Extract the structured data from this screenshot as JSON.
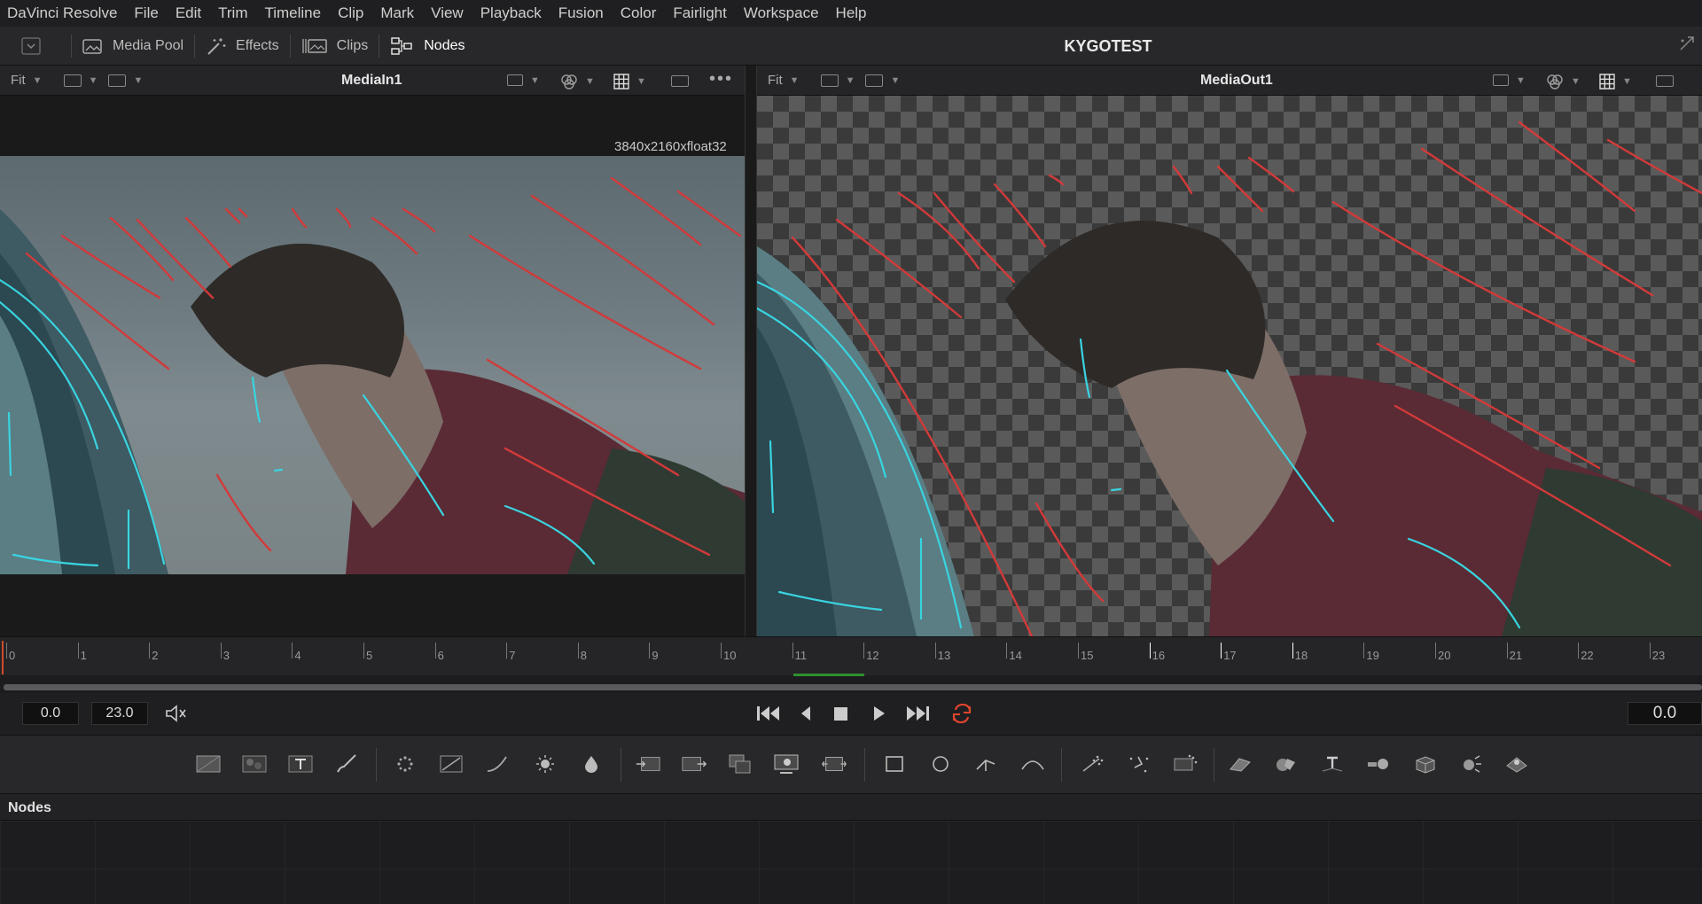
{
  "menubar": {
    "items": [
      "DaVinci Resolve",
      "File",
      "Edit",
      "Trim",
      "Timeline",
      "Clip",
      "Mark",
      "View",
      "Playback",
      "Fusion",
      "Color",
      "Fairlight",
      "Workspace",
      "Help"
    ]
  },
  "toolbar": {
    "media_pool": "Media Pool",
    "effects": "Effects",
    "clips": "Clips",
    "nodes": "Nodes",
    "project_title": "KYGOTEST"
  },
  "viewer_left": {
    "zoom": "Fit",
    "title": "MediaIn1",
    "resolution": "3840x2160xfloat32"
  },
  "viewer_right": {
    "zoom": "Fit",
    "title": "MediaOut1"
  },
  "ruler": {
    "frames": [
      "0",
      "1",
      "2",
      "3",
      "4",
      "5",
      "6",
      "7",
      "8",
      "9",
      "10",
      "11",
      "12",
      "13",
      "14",
      "15",
      "16",
      "17",
      "18",
      "19",
      "20",
      "21",
      "22",
      "23"
    ]
  },
  "transport": {
    "start_time": "0.0",
    "end_time": "23.0",
    "current_time": "0.0"
  },
  "nodes_panel": {
    "title": "Nodes"
  },
  "colors": {
    "tracker_red": "#d23a3a",
    "tracker_cyan": "#39d4e0",
    "loop_icon": "#e0452e",
    "playhead": "#d04a2a"
  }
}
